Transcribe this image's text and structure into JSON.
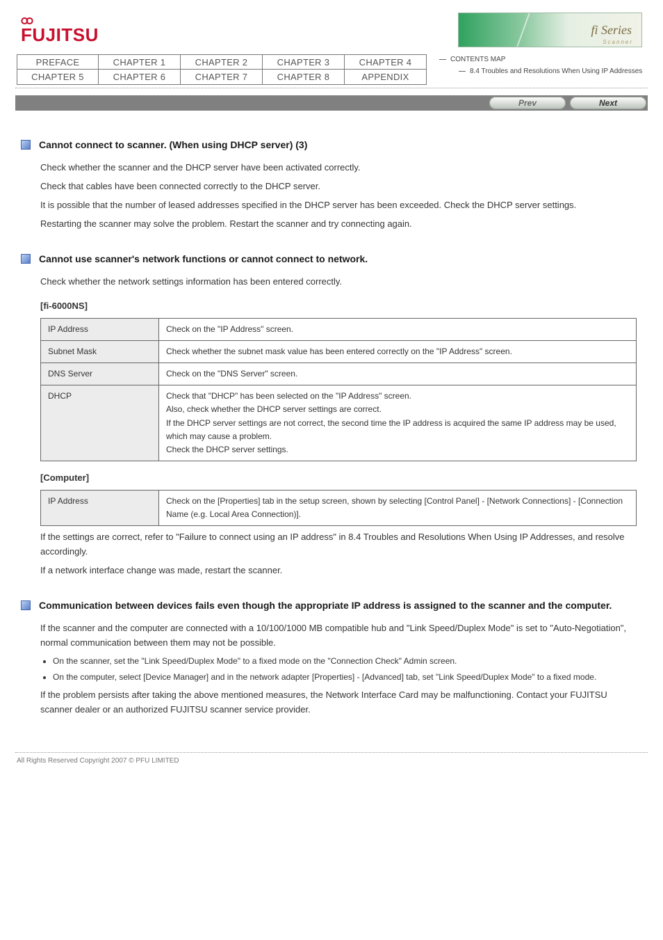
{
  "header": {
    "logo_text": "FUJITSU",
    "fi_badge_text": "fi Series",
    "fi_badge_sub": "Scanner"
  },
  "nav": {
    "row1": [
      "PREFACE",
      "CHAPTER 1",
      "CHAPTER 2",
      "CHAPTER 3",
      "CHAPTER 4"
    ],
    "row2": [
      "CHAPTER 5",
      "CHAPTER 6",
      "CHAPTER 7",
      "CHAPTER 8",
      "APPENDIX"
    ],
    "side_top": "CONTENTS MAP",
    "side_sub": "8.4 Troubles and Resolutions When Using IP Addresses"
  },
  "bar": {
    "prev": "Prev",
    "next": "Next"
  },
  "s1": {
    "title": "Cannot connect to scanner. (When using DHCP server) (3)",
    "p1": "Check whether the scanner and the DHCP server have been activated correctly.",
    "p2": "Check that cables have been connected correctly to the DHCP server.",
    "p3": "It is possible that the number of leased addresses specified in the DHCP server has been exceeded. Check the DHCP server settings.",
    "p4": "Restarting the scanner may solve the problem. Restart the scanner and try connecting again."
  },
  "s2": {
    "title": "Cannot use scanner's network functions or cannot connect to network.",
    "p1": "Check whether the network settings information has been entered correctly.",
    "sub1": "[fi-6000NS]",
    "t1": {
      "r1": [
        "IP Address",
        "Check on the \"IP Address\" screen."
      ],
      "r2": [
        "Subnet Mask",
        "Check whether the subnet mask value has been entered correctly on the \"IP Address\" screen."
      ],
      "r3": [
        "DNS Server",
        "Check on the \"DNS Server\" screen."
      ],
      "r4": [
        "DHCP",
        "Check that \"DHCP\" has been selected on the \"IP Address\" screen.\nAlso, check whether the DHCP server settings are correct.\nIf the DHCP server settings are not correct, the second time the IP address is acquired the same IP address may be used, which may cause a problem.\nCheck the DHCP server settings."
      ]
    },
    "sub2": "[Computer]",
    "t2": {
      "r1": [
        "IP Address",
        "Check on the [Properties] tab in the setup screen, shown by selecting [Control Panel] - [Network Connections] - [Connection Name (e.g. Local Area Connection)]."
      ]
    },
    "p2": "If the settings are correct, refer to \"Failure to connect using an IP address\" in 8.4 Troubles and Resolutions When Using IP Addresses, and resolve accordingly.",
    "p3": "If a network interface change was made, restart the scanner."
  },
  "s3": {
    "title": "Communication between devices fails even though the appropriate IP address is assigned to the scanner and the computer.",
    "p1": "If the scanner and the computer are connected with a 10/100/1000 MB compatible hub and \"Link Speed/Duplex Mode\" is set to \"Auto-Negotiation\", normal communication between them may not be possible.",
    "items": [
      "On the scanner, set the \"Link Speed/Duplex Mode\" to a fixed mode on the \"Connection Check\" Admin screen.",
      "On the computer, select [Device Manager] and in the network adapter [Properties] - [Advanced] tab, set \"Link Speed/Duplex Mode\" to a fixed mode."
    ],
    "p2": "If the problem persists after taking the above mentioned measures, the Network Interface Card may be malfunctioning. Contact your FUJITSU scanner dealer or an authorized FUJITSU scanner service provider."
  },
  "footer": "All Rights Reserved Copyright 2007 © PFU LIMITED"
}
